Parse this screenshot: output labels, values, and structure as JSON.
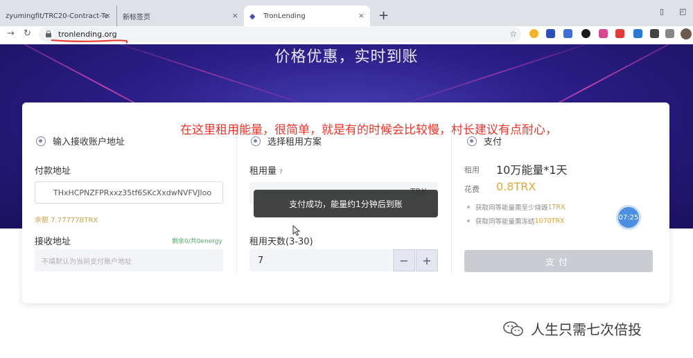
{
  "browser": {
    "tabs": [
      {
        "label": "zyumingfit/TRC20-Contract-Te",
        "close": "×"
      },
      {
        "label": "新标签页",
        "close": "×"
      },
      {
        "label": "TronLending",
        "close": "×"
      }
    ],
    "new_tab": "+",
    "url": "tronlending.org",
    "accent_underline": "#e8352b"
  },
  "hero": {
    "title": "价格优惠，实时到账"
  },
  "receive": {
    "heading": "输入接收账户地址",
    "pay_address_label": "付款地址",
    "pay_address_value": "THxHCPNZFPRxxz35tf6SKcXxdwNVFVJloo",
    "balance": "余额 7.77777BTRX",
    "receive_label": "接收地址",
    "receive_quota": "剩余0/共0energy",
    "receive_placeholder": "不填默认为当前支付账户地址"
  },
  "plan": {
    "heading": "选择租用方案",
    "amount_label": "租用量",
    "amount_help": "?",
    "amount_unit": "TRX",
    "days_label": "租用天数(3-30)",
    "days_value": "7",
    "minus": "−",
    "plus": "+"
  },
  "payment": {
    "heading": "支付",
    "rent_key": "租用",
    "rent_value": "10万能量*1天",
    "cost_key": "花费",
    "cost_value": "0.8TRX",
    "bullet1_text": "获取同等能量需至少烧毁",
    "bullet1_value": "1TRX",
    "bullet2_text": "获取同等能量需冻结",
    "bullet2_value": "1070TRX",
    "pay_button": "支付",
    "timer": "07:25"
  },
  "toast": "支付成功，能量约1分钟后到账",
  "annotation": "在这里租用能量，很简单，就是有的时候会比较慢，村长建议有点耐心，",
  "watermark": "人生只需七次倍投"
}
